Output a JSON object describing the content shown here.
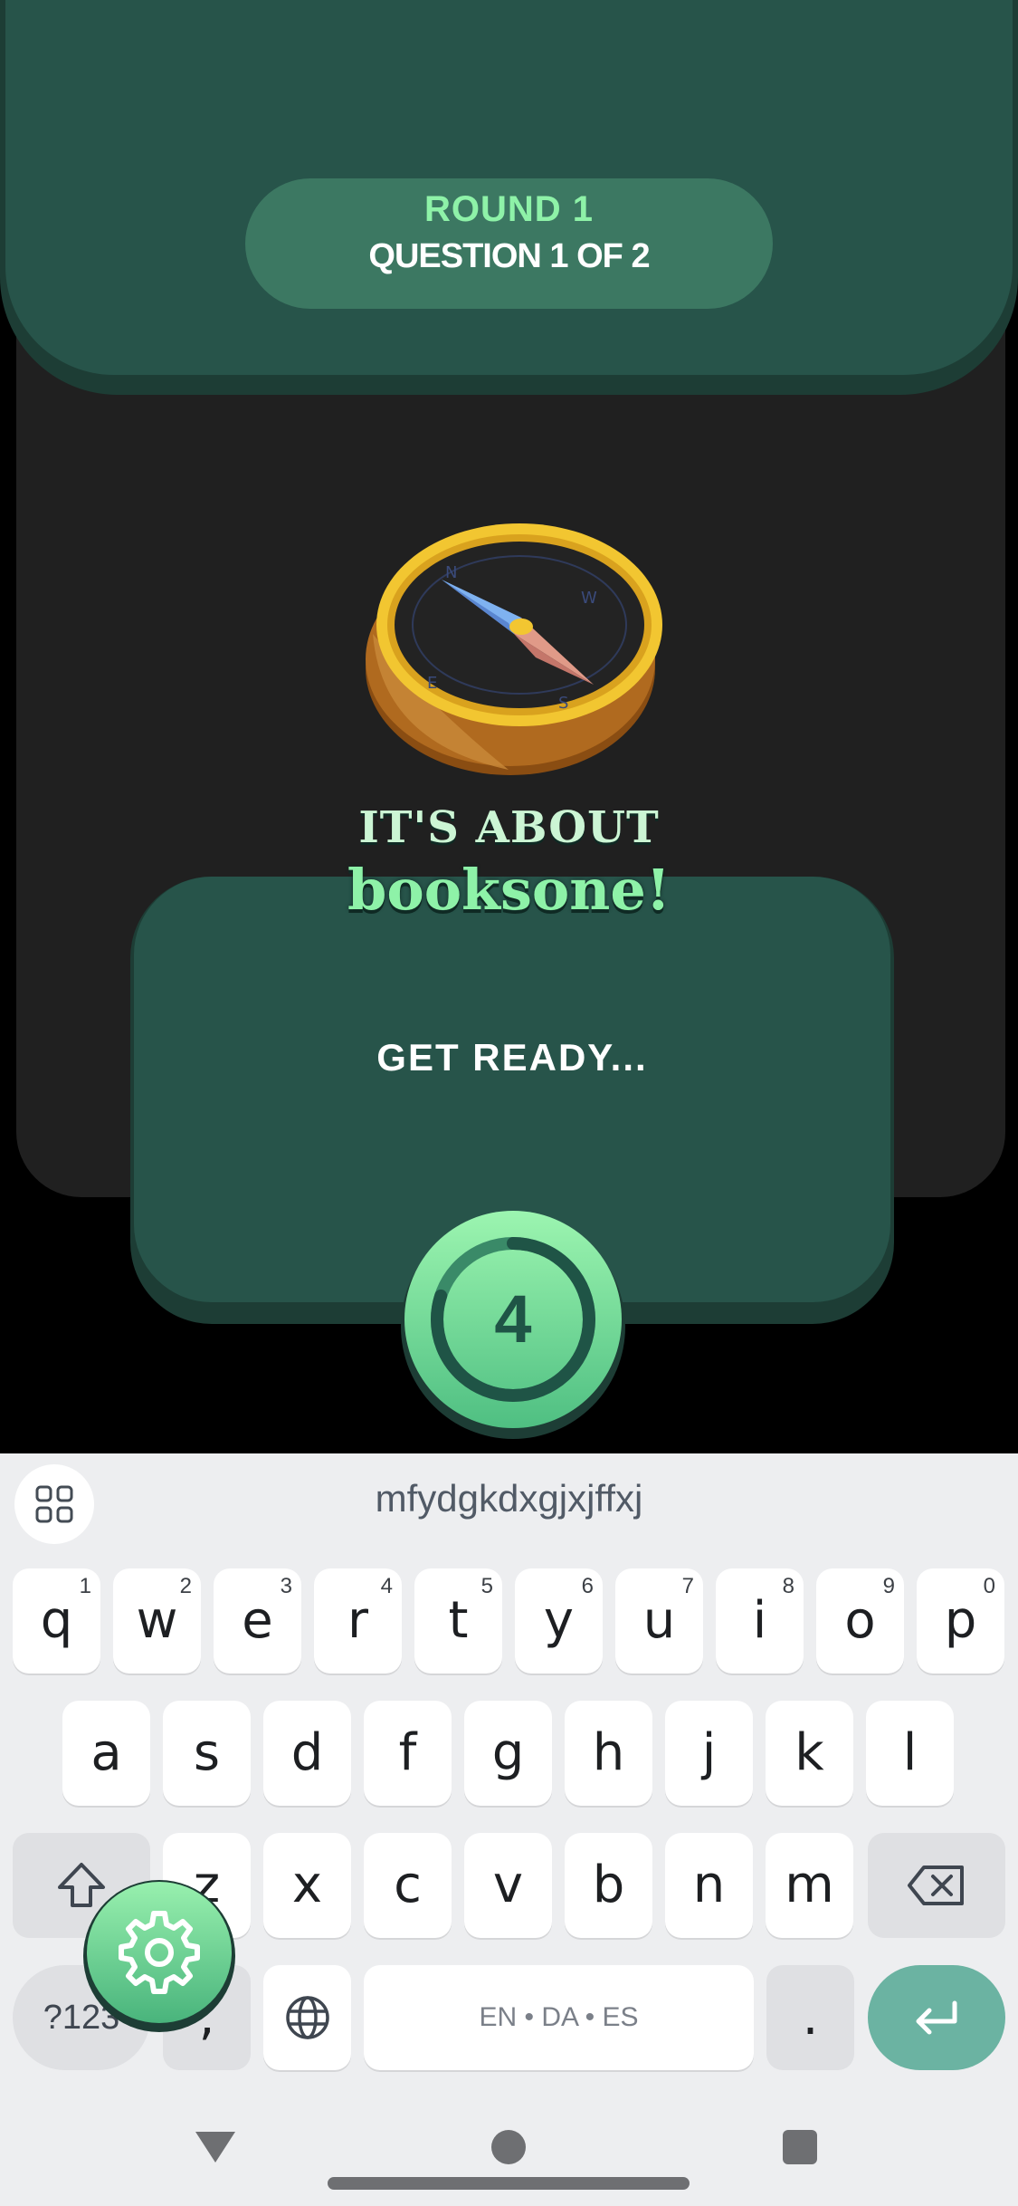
{
  "game": {
    "round_label": "ROUND 1",
    "question_label": "QUESTION 1 OF 2",
    "about_label": "IT'S ABOUT",
    "topic": "booksone!",
    "status_text": "GET READY...",
    "countdown": "4",
    "countdown_fraction": 0.8,
    "colors": {
      "accent_green": "#8ef2a8",
      "card_green": "#27544a",
      "pill_green": "#3c7862"
    }
  },
  "keyboard": {
    "suggestion": "mfydgkdxgjxjffxj",
    "row1": [
      {
        "label": "q",
        "hint": "1"
      },
      {
        "label": "w",
        "hint": "2"
      },
      {
        "label": "e",
        "hint": "3"
      },
      {
        "label": "r",
        "hint": "4"
      },
      {
        "label": "t",
        "hint": "5"
      },
      {
        "label": "y",
        "hint": "6"
      },
      {
        "label": "u",
        "hint": "7"
      },
      {
        "label": "i",
        "hint": "8"
      },
      {
        "label": "o",
        "hint": "9"
      },
      {
        "label": "p",
        "hint": "0"
      }
    ],
    "row2": [
      "a",
      "s",
      "d",
      "f",
      "g",
      "h",
      "j",
      "k",
      "l"
    ],
    "row3": [
      "z",
      "x",
      "c",
      "v",
      "b",
      "n",
      "m"
    ],
    "symbols_label": "?123",
    "comma_label": ",",
    "space_label": "EN • DA • ES",
    "period_label": ".",
    "icons": {
      "suggest": "grid-icon",
      "shift": "shift-icon",
      "backspace": "backspace-icon",
      "language": "globe-icon",
      "enter": "enter-icon",
      "settings": "gear-icon"
    },
    "enter_color": "#6bb3a2"
  },
  "navbar": {
    "icons": [
      "back-icon",
      "home-icon",
      "recents-icon"
    ]
  }
}
